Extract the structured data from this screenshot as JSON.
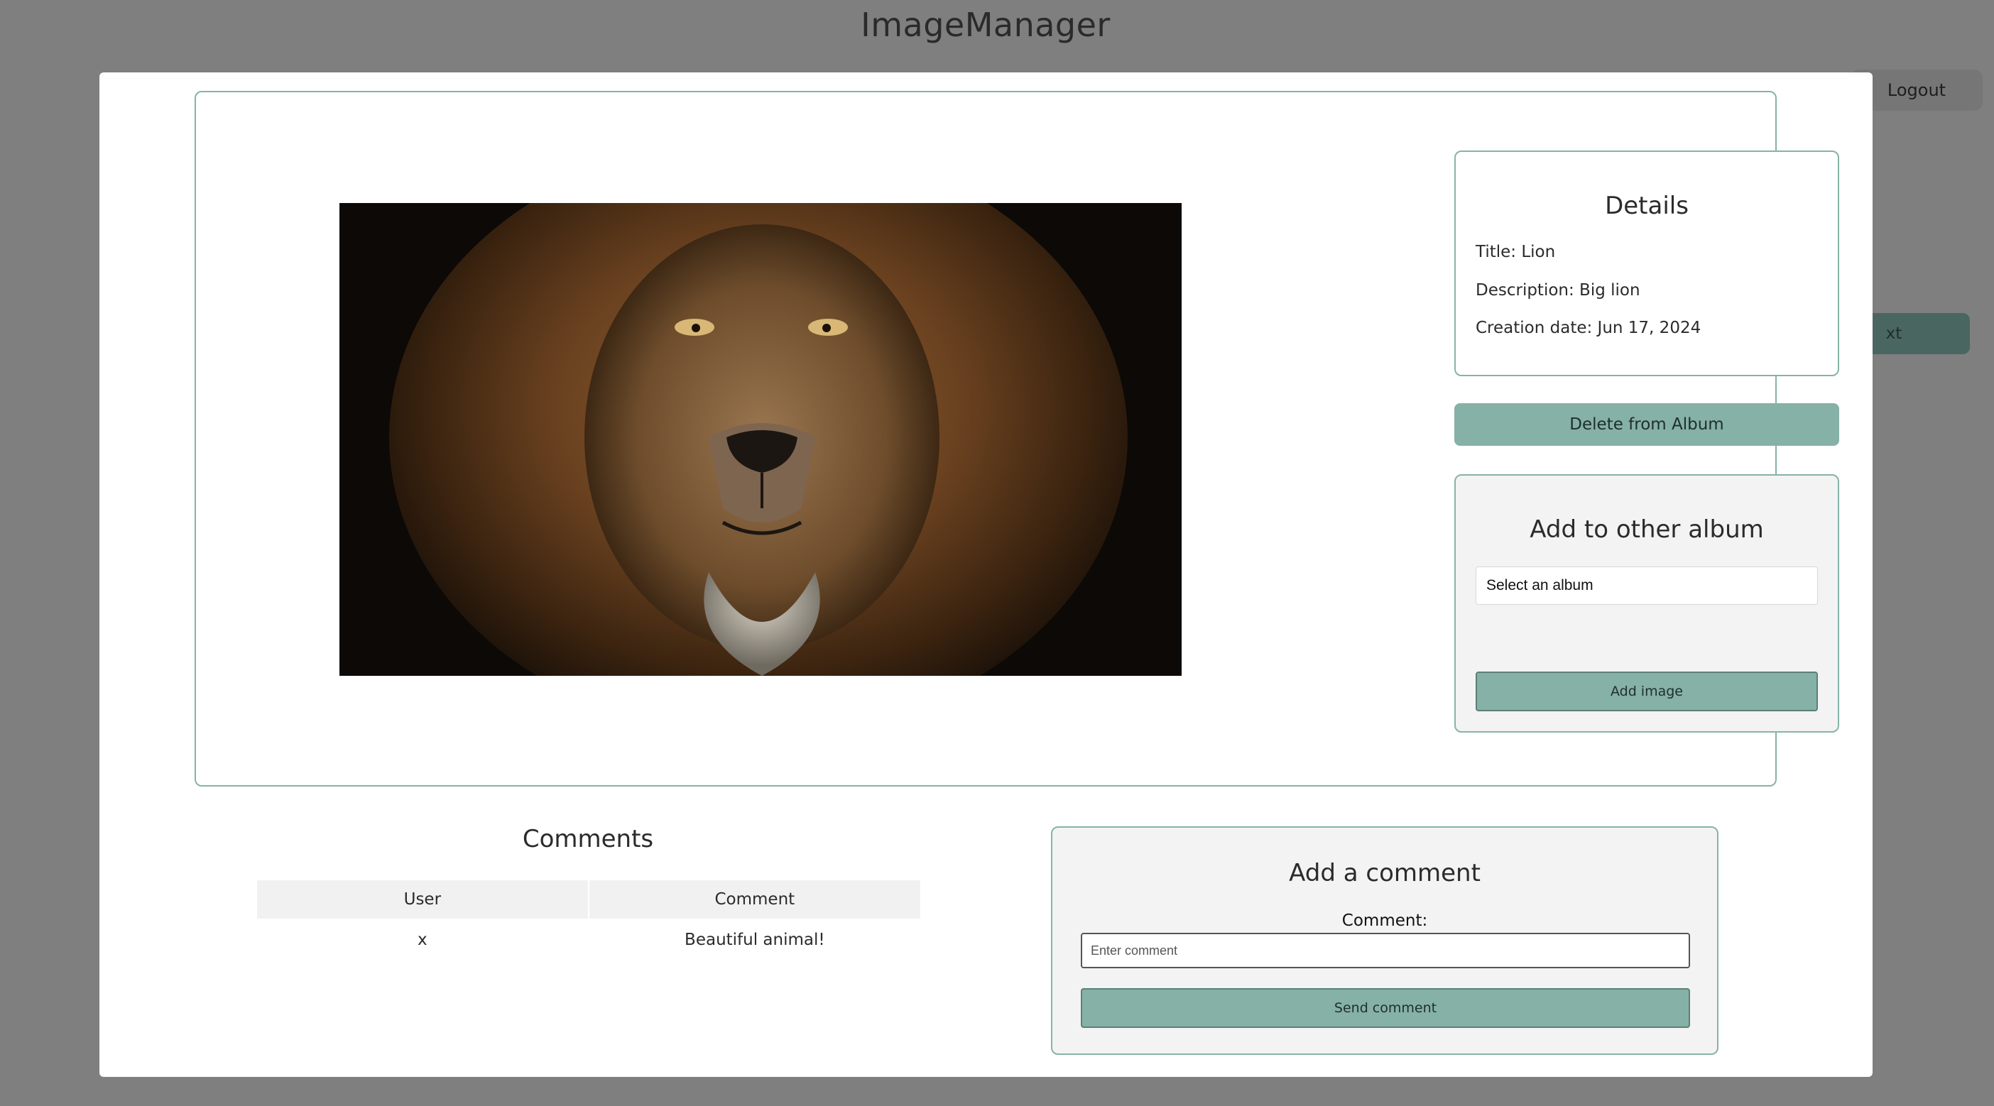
{
  "app": {
    "title": "ImageManager",
    "logout_label": "Logout",
    "next_label": "xt"
  },
  "image": {
    "alt": "Lion"
  },
  "details": {
    "heading": "Details",
    "title_line": "Title: Lion",
    "description_line": "Description: Big lion",
    "date_line": "Creation date: Jun 17, 2024"
  },
  "actions": {
    "delete_label": "Delete from Album"
  },
  "add_album": {
    "heading": "Add to other album",
    "select_value": "Select an album",
    "add_label": "Add image"
  },
  "comments": {
    "heading": "Comments",
    "columns": [
      "User",
      "Comment"
    ],
    "rows": [
      {
        "user": "x",
        "comment": "Beautiful animal!"
      }
    ]
  },
  "add_comment": {
    "heading": "Add a comment",
    "label": "Comment:",
    "placeholder": "Enter comment",
    "send_label": "Send comment"
  },
  "colors": {
    "accent": "#86b1a6",
    "accent_border": "#86b3a8",
    "overlay": "#7f7f7f"
  }
}
